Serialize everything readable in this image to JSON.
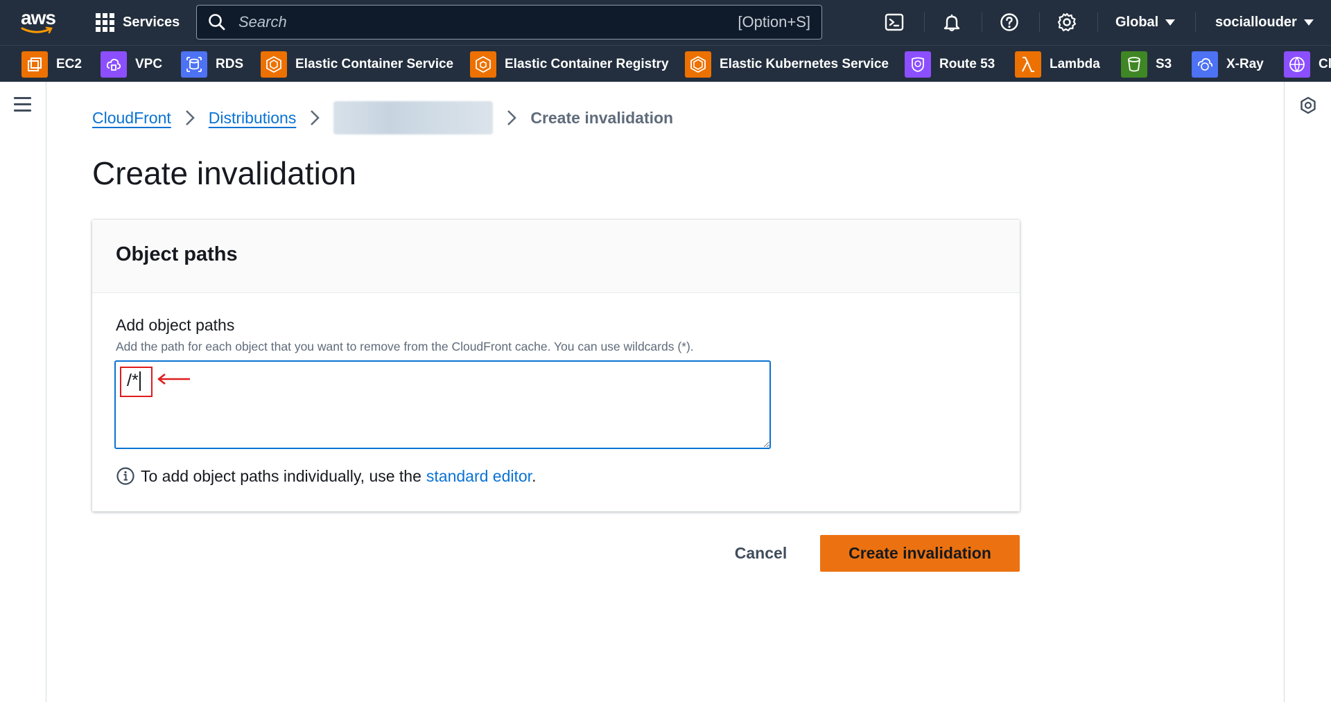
{
  "topnav": {
    "logo_text": "aws",
    "services_label": "Services",
    "search_placeholder": "Search",
    "search_shortcut": "[Option+S]",
    "region_label": "Global",
    "account_label": "sociallouder",
    "icons": [
      "cloudshell-icon",
      "bell-icon",
      "help-icon",
      "settings-icon"
    ]
  },
  "favorites": [
    {
      "label": "EC2",
      "icon": "ec2-icon",
      "color": "#ed7100"
    },
    {
      "label": "VPC",
      "icon": "vpc-icon",
      "color": "#8c4fff"
    },
    {
      "label": "RDS",
      "icon": "rds-icon",
      "color": "#4d72f3"
    },
    {
      "label": "Elastic Container Service",
      "icon": "ecs-icon",
      "color": "#ed7100"
    },
    {
      "label": "Elastic Container Registry",
      "icon": "ecr-icon",
      "color": "#ed7100"
    },
    {
      "label": "Elastic Kubernetes Service",
      "icon": "eks-icon",
      "color": "#ed7100"
    },
    {
      "label": "Route 53",
      "icon": "route53-icon",
      "color": "#8c4fff"
    },
    {
      "label": "Lambda",
      "icon": "lambda-icon",
      "color": "#ed7100"
    },
    {
      "label": "S3",
      "icon": "s3-icon",
      "color": "#3f8624"
    },
    {
      "label": "X-Ray",
      "icon": "xray-icon",
      "color": "#4d72f3"
    },
    {
      "label": "Cl",
      "icon": "cloudfront-icon",
      "color": "#8c4fff"
    }
  ],
  "breadcrumb": {
    "items": [
      "CloudFront",
      "Distributions"
    ],
    "current": "Create invalidation"
  },
  "page": {
    "title": "Create invalidation"
  },
  "panel": {
    "title": "Object paths",
    "field_label": "Add object paths",
    "field_description": "Add the path for each object that you want to remove from the CloudFront cache. You can use wildcards (*).",
    "textarea_value": "/*",
    "hint_prefix": "To add object paths individually, use the",
    "hint_link": "standard editor",
    "hint_suffix": "."
  },
  "actions": {
    "cancel_label": "Cancel",
    "submit_label": "Create invalidation"
  },
  "colors": {
    "nav_bg": "#232f3e",
    "link": "#0972d3",
    "primary": "#ec7211",
    "annotation": "#e01b1b"
  }
}
